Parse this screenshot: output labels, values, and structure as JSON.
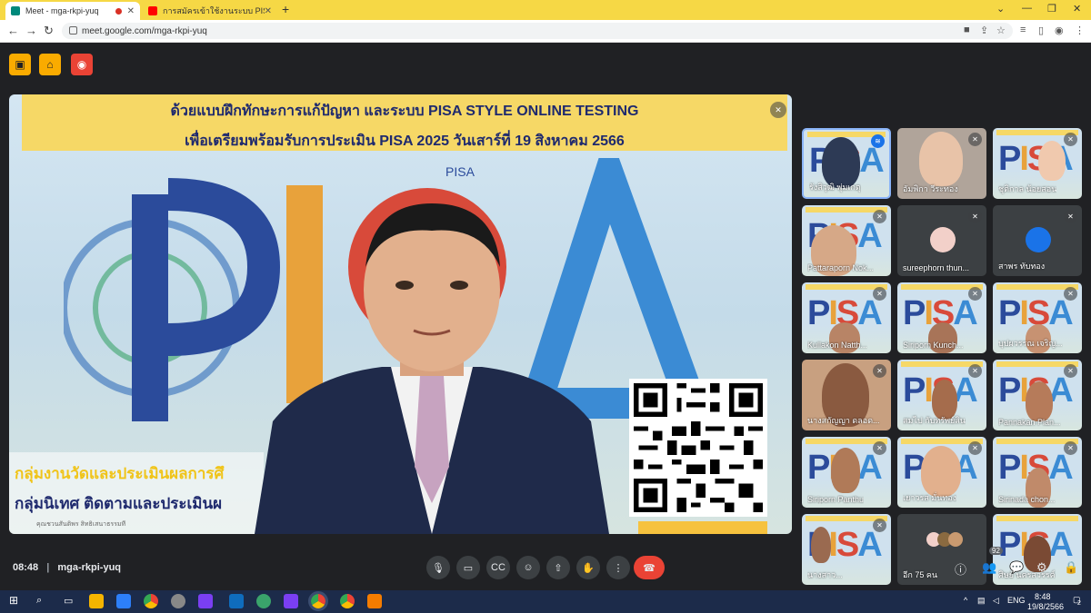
{
  "browser": {
    "tabs": [
      {
        "title": "Meet - mga-rkpi-yuq",
        "recording": true
      },
      {
        "title": "การสมัครเข้าใช้งานระบบ PISA STYLE"
      }
    ],
    "url": "meet.google.com/mga-rkpi-yuq",
    "new_tab": "+",
    "min": "—",
    "max": "❐",
    "close": "✕"
  },
  "presentation": {
    "banner_line1": "ด้วยแบบฝึกทักษะการแก้ปัญหา และระบบ PISA STYLE ONLINE TESTING",
    "banner_line2": "เพื่อเตรียมพร้อมรับการประเมิน PISA 2025 วันเสาร์ที่ 19 สิงหาคม 2566",
    "logo_text": "PISA",
    "bottom_line1": "กลุ่มงานวัดและประเมินผลการศึ",
    "bottom_line2": "กลุ่มนิเทศ ติดตามและประเมินผ",
    "bottom_tiny": "คุณชวนสันติพร สิทธิเสนาธรรมที"
  },
  "participants": [
    {
      "name": "รังสิวุฒิ พุ่มเกตุ",
      "speaking": true
    },
    {
      "name": "อัมพิกา วีระทอง"
    },
    {
      "name": "ชุติกาล น้อยสอน"
    },
    {
      "name": "Pattaraporn Nok..."
    },
    {
      "name": "sureephorn thun..."
    },
    {
      "name": "สาพร ทับทอง"
    },
    {
      "name": "Kullakon Natth..."
    },
    {
      "name": "Siriporn Kunch..."
    },
    {
      "name": "บุปผวรรณ เจริญ..."
    },
    {
      "name": "นางสกัญญา ดลอด..."
    },
    {
      "name": "สมไป กับทรัพย์สิน"
    },
    {
      "name": "Pannakan Plan..."
    },
    {
      "name": "Siriporn Panthu"
    },
    {
      "name": "เยาวรส มั่นทอง"
    },
    {
      "name": "Sirinada chon..."
    },
    {
      "name": "นางสาว..."
    },
    {
      "name": "อีก 75 คน"
    },
    {
      "name": "ศิษย์ นครสวรรค์"
    }
  ],
  "controls": {
    "time": "08:48",
    "separator": "|",
    "meeting_code": "mga-rkpi-yuq",
    "people_count": "92"
  },
  "taskbar": {
    "lang": "ENG",
    "clock_time": "8:48",
    "clock_date": "19/8/2566",
    "notif": "2"
  },
  "colors": {
    "tab_bar": "#f6d845",
    "meet_bg": "#202124",
    "end_call": "#ea4335",
    "active_border": "#8ab4f8",
    "banner": "#f6d866"
  }
}
